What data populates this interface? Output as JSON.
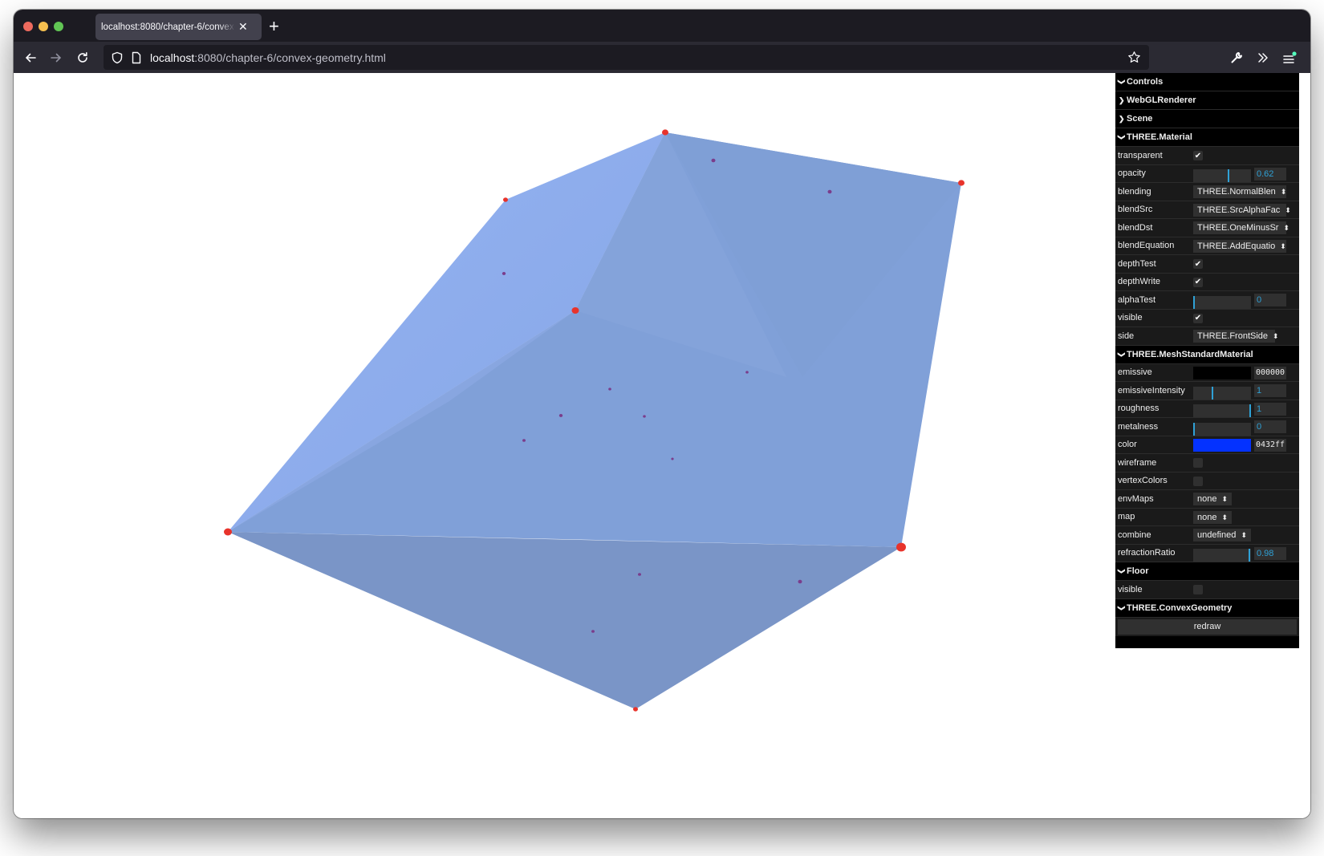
{
  "browser": {
    "tab_title": "localhost:8080/chapter-6/convex-geometry.html",
    "url_host": "localhost",
    "url_rest": ":8080/chapter-6/convex-geometry.html",
    "traffic_light_colors": [
      "#ed6a5e",
      "#f5bf4f",
      "#61c554"
    ],
    "icons": {
      "back": "arrow-left-icon",
      "forward": "arrow-right-icon",
      "reload": "reload-icon",
      "tracking": "shield-icon",
      "page": "page-icon",
      "bookmark": "star-icon",
      "devtools": "wrench-icon",
      "overflow": "chevrons-right-icon",
      "menu": "hamburger-menu-icon"
    }
  },
  "scene": {
    "mesh_color": "#7f9ed6",
    "point_color": "#e8332b"
  },
  "gui": {
    "controls_title": "Controls",
    "folders": {
      "webgl": "WebGLRenderer",
      "scene": "Scene",
      "material": "THREE.Material",
      "standard": "THREE.MeshStandardMaterial",
      "floor": "Floor",
      "convex": "THREE.ConvexGeometry"
    },
    "material": {
      "transparent": {
        "label": "transparent",
        "checked": true
      },
      "opacity": {
        "label": "opacity",
        "value": "0.62",
        "fraction": 0.62
      },
      "blending": {
        "label": "blending",
        "value": "THREE.NormalBlen"
      },
      "blendSrc": {
        "label": "blendSrc",
        "value": "THREE.SrcAlphaFac"
      },
      "blendDst": {
        "label": "blendDst",
        "value": "THREE.OneMinusSr"
      },
      "blendEquation": {
        "label": "blendEquation",
        "value": "THREE.AddEquatio"
      },
      "depthTest": {
        "label": "depthTest",
        "checked": true
      },
      "depthWrite": {
        "label": "depthWrite",
        "checked": true
      },
      "alphaTest": {
        "label": "alphaTest",
        "value": "0",
        "fraction": 0
      },
      "visible": {
        "label": "visible",
        "checked": true
      },
      "side": {
        "label": "side",
        "value": "THREE.FrontSide"
      }
    },
    "standard": {
      "emissive": {
        "label": "emissive",
        "value": "000000",
        "swatch": "#000000"
      },
      "emissiveIntensity": {
        "label": "emissiveIntensity",
        "value": "1",
        "fraction": 0.33
      },
      "roughness": {
        "label": "roughness",
        "value": "1",
        "fraction": 1.0
      },
      "metalness": {
        "label": "metalness",
        "value": "0",
        "fraction": 0
      },
      "color": {
        "label": "color",
        "value": "0432ff",
        "swatch": "#0432ff"
      },
      "wireframe": {
        "label": "wireframe",
        "checked": false
      },
      "vertexColors": {
        "label": "vertexColors",
        "checked": false
      },
      "envMaps": {
        "label": "envMaps",
        "value": "none"
      },
      "map": {
        "label": "map",
        "value": "none"
      },
      "combine": {
        "label": "combine",
        "value": "undefined"
      },
      "refractionRatio": {
        "label": "refractionRatio",
        "value": "0.98",
        "fraction": 0.98
      }
    },
    "floor": {
      "visible": {
        "label": "visible",
        "checked": false
      }
    },
    "convex": {
      "redraw_label": "redraw"
    },
    "accent_color": "#2fa1d6"
  }
}
